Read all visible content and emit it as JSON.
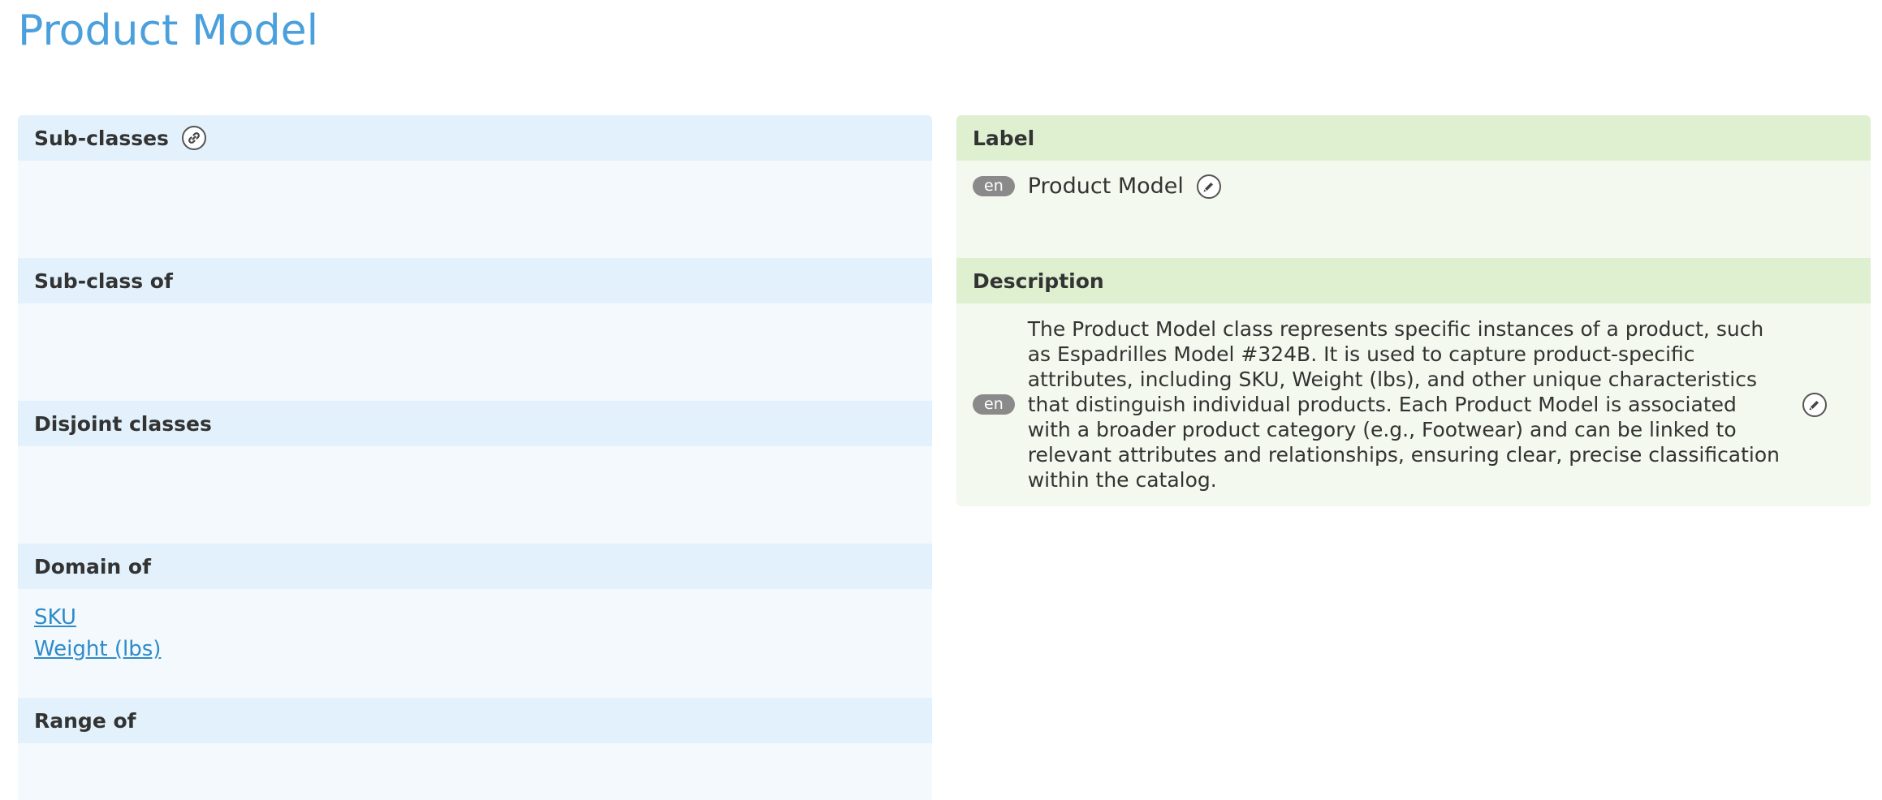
{
  "page": {
    "title": "Product Model"
  },
  "left": {
    "subclasses": {
      "title": "Sub-classes",
      "icon": "link-icon"
    },
    "subclass_of": {
      "title": "Sub-class of"
    },
    "disjoint": {
      "title": "Disjoint classes"
    },
    "domain_of": {
      "title": "Domain of",
      "items": [
        "SKU",
        "Weight (lbs)"
      ]
    },
    "range_of": {
      "title": "Range of"
    }
  },
  "right": {
    "label": {
      "title": "Label",
      "lang": "en",
      "value": "Product Model",
      "icon": "edit-icon"
    },
    "description": {
      "title": "Description",
      "lang": "en",
      "value": "The Product Model class represents specific instances of a product, such as Espadrilles Model #324B. It is used to capture product-specific attributes, including SKU, Weight (lbs), and other unique characteristics that distinguish individual products. Each Product Model is associated with a broader product category (e.g., Footwear) and can be linked to relevant attributes and relationships, ensuring clear, precise classification within the catalog.",
      "icon": "edit-icon"
    }
  },
  "colors": {
    "title": "#4aa0dc",
    "blue_header": "#e2f1fb",
    "blue_body": "#f3f9fd",
    "green_header": "#dff0d1",
    "green_body": "#f3f9ee",
    "link": "#2e8bc9",
    "badge": "#8a8a8a"
  }
}
